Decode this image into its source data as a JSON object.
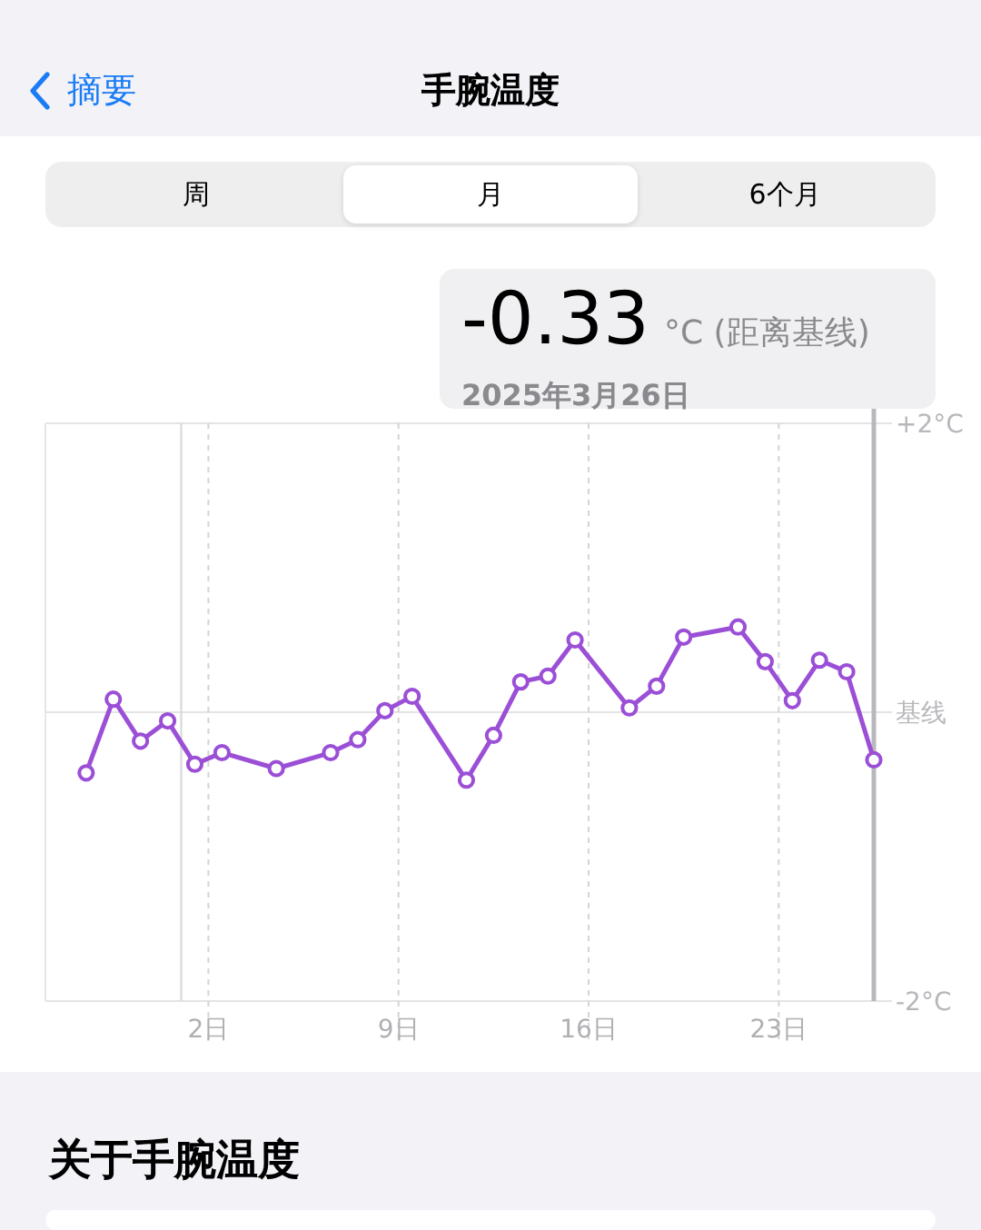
{
  "nav": {
    "back_label": "摘要",
    "title": "手腕温度"
  },
  "segments": [
    {
      "label": "周",
      "selected": false
    },
    {
      "label": "月",
      "selected": true
    },
    {
      "label": "6个月",
      "selected": false
    }
  ],
  "readout": {
    "value": "-0.33",
    "unit": "°C (距离基线)",
    "date": "2025年3月26日"
  },
  "chart": {
    "chart_data": {
      "type": "line",
      "x": [
        -3,
        -2,
        -1,
        0,
        1,
        2,
        4,
        6,
        7,
        8,
        9,
        11,
        12,
        13,
        14,
        15,
        17,
        18,
        19,
        21,
        22,
        23,
        24,
        25,
        26
      ],
      "grid": true,
      "ref_lines": [
        {
          "axis": "x",
          "value": 0.5
        }
      ],
      "series": [
        {
          "color": "#9b4fd6",
          "marker": "circle",
          "values": [
            -0.42,
            0.09,
            -0.2,
            -0.06,
            -0.36,
            -0.28,
            -0.39,
            -0.28,
            -0.19,
            0.01,
            0.11,
            -0.47,
            -0.16,
            0.21,
            0.25,
            0.5,
            0.03,
            0.18,
            0.52,
            0.59,
            0.35,
            0.08,
            0.36,
            0.28,
            -0.33
          ]
        }
      ],
      "xlim": [
        -4.5,
        26
      ],
      "ylim": [
        -2,
        2
      ],
      "xticks": [
        {
          "value": 1.5,
          "label": "2日"
        },
        {
          "value": 8.5,
          "label": "9日"
        },
        {
          "value": 15.5,
          "label": "16日"
        },
        {
          "value": 22.5,
          "label": "23日"
        }
      ],
      "yticks": [
        {
          "value": 2,
          "label": "+2°C"
        },
        {
          "value": 0,
          "label": "基线"
        },
        {
          "value": -2,
          "label": "-2°C"
        }
      ]
    }
  },
  "about": {
    "heading": "关于手腕温度"
  }
}
